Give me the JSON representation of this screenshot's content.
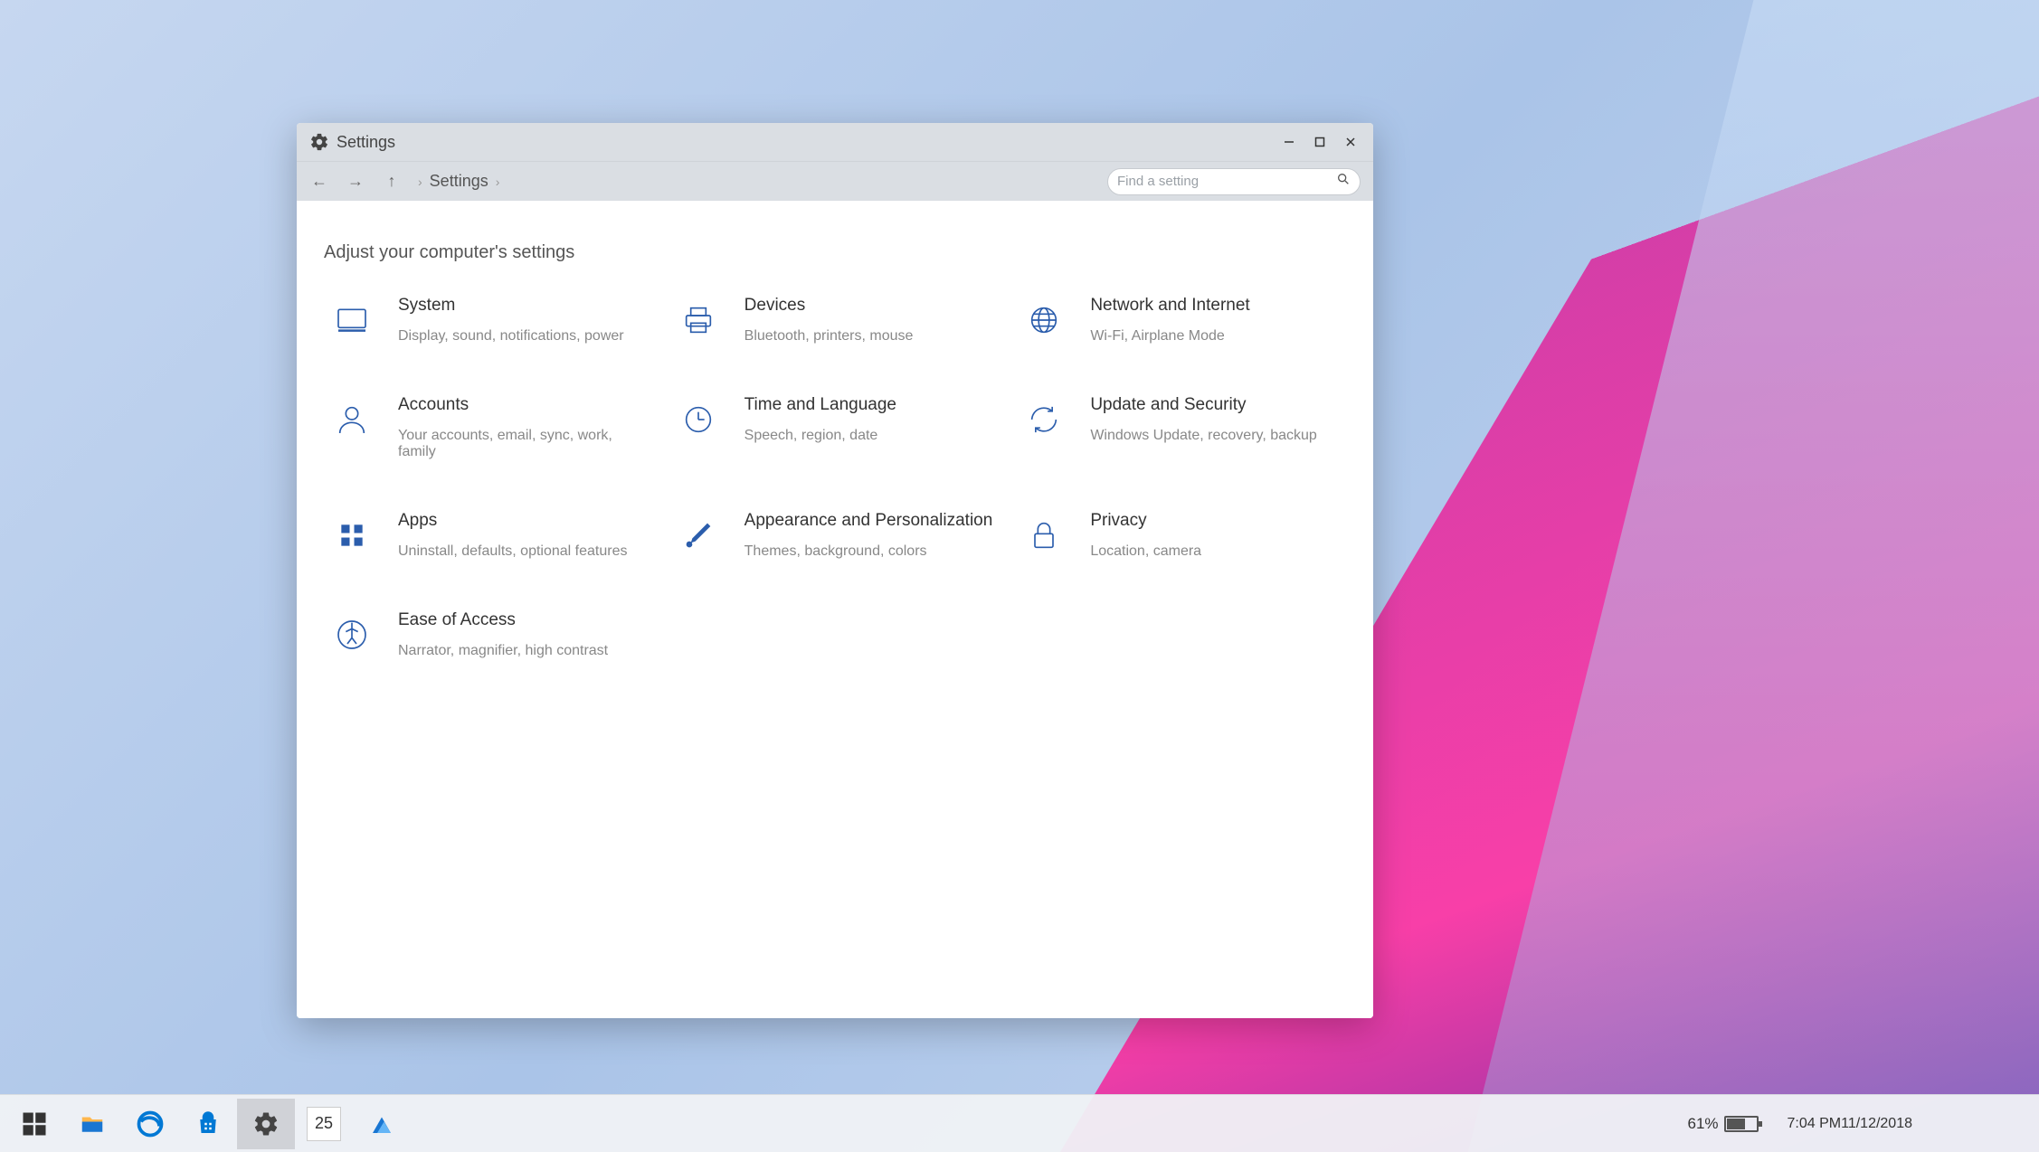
{
  "window": {
    "title": "Settings",
    "breadcrumb": "Settings",
    "search_placeholder": "Find a setting",
    "heading": "Adjust your computer's settings"
  },
  "categories": [
    {
      "title": "System",
      "subtitle": "Display, sound, notifications, power"
    },
    {
      "title": "Devices",
      "subtitle": "Bluetooth, printers, mouse"
    },
    {
      "title": "Network and Internet",
      "subtitle": "Wi-Fi, Airplane Mode"
    },
    {
      "title": "Accounts",
      "subtitle": "Your accounts, email, sync, work, family"
    },
    {
      "title": "Time and Language",
      "subtitle": "Speech, region, date"
    },
    {
      "title": "Update and Security",
      "subtitle": "Windows Update, recovery, backup"
    },
    {
      "title": "Apps",
      "subtitle": "Uninstall, defaults, optional features"
    },
    {
      "title": "Appearance and Personalization",
      "subtitle": "Themes, background, colors"
    },
    {
      "title": "Privacy",
      "subtitle": "Location, camera"
    },
    {
      "title": "Ease of Access",
      "subtitle": "Narrator, magnifier, high contrast"
    }
  ],
  "taskbar": {
    "calendar_day": "25",
    "battery_percent": "61%",
    "time": "7:04 PM",
    "date": "11/12/2018"
  }
}
